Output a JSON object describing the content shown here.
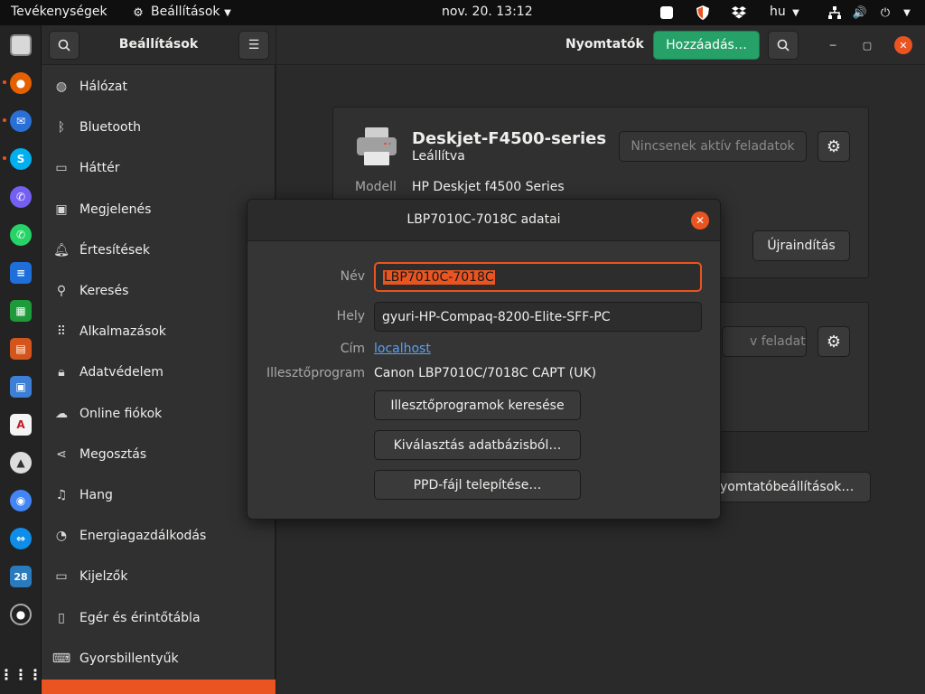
{
  "topbar": {
    "activities": "Tevékenységek",
    "app_menu": "Beállítások",
    "clock": "nov. 20.  13:12",
    "lang": "hu"
  },
  "sidebar": {
    "title": "Beállítások",
    "items": [
      {
        "label": "Hálózat",
        "icon": "network-icon"
      },
      {
        "label": "Bluetooth",
        "icon": "bluetooth-icon"
      },
      {
        "label": "Háttér",
        "icon": "background-icon"
      },
      {
        "label": "Megjelenés",
        "icon": "appearance-icon"
      },
      {
        "label": "Értesítések",
        "icon": "bell-icon"
      },
      {
        "label": "Keresés",
        "icon": "search-icon"
      },
      {
        "label": "Alkalmazások",
        "icon": "apps-grid-icon"
      },
      {
        "label": "Adatvédelem",
        "icon": "lock-icon"
      },
      {
        "label": "Online fiókok",
        "icon": "cloud-icon"
      },
      {
        "label": "Megosztás",
        "icon": "share-icon"
      },
      {
        "label": "Hang",
        "icon": "music-note-icon"
      },
      {
        "label": "Energiagazdálkodás",
        "icon": "power-icon"
      },
      {
        "label": "Kijelzők",
        "icon": "display-icon"
      },
      {
        "label": "Egér és érintőtábla",
        "icon": "mouse-icon"
      },
      {
        "label": "Gyorsbillentyűk",
        "icon": "keyboard-icon"
      }
    ]
  },
  "main": {
    "title": "Nyomtatók",
    "add_button": "Hozzáadás…"
  },
  "printer1": {
    "name": "Deskjet-F4500-series",
    "status": "Leállítva",
    "jobs_button": "Nincsenek aktív feladatok",
    "model_label": "Modell",
    "model_value": "HP Deskjet f4500 Series",
    "restart_button": "Újraindítás"
  },
  "printer2": {
    "jobs_button_partial": "v feladatok",
    "settings_button_partial": "yomtatóbeállítások…"
  },
  "dialog": {
    "title": "LBP7010C-7018C adatai",
    "name_label": "Név",
    "name_value": "LBP7010C-7018C",
    "location_label": "Hely",
    "location_value": "gyuri-HP-Compaq-8200-Elite-SFF-PC",
    "address_label": "Cím",
    "address_value": "localhost",
    "driver_label": "Illesztőprogram",
    "driver_value": "Canon LBP7010C/7018C CAPT (UK)",
    "search_drivers": "Illesztőprogramok keresése",
    "select_from_db": "Kiválasztás adatbázisból…",
    "install_ppd": "PPD-fájl telepítése…"
  },
  "dock": {
    "badge_text": "28"
  },
  "colors": {
    "accent": "#e95420",
    "add_green": "#26a269"
  }
}
